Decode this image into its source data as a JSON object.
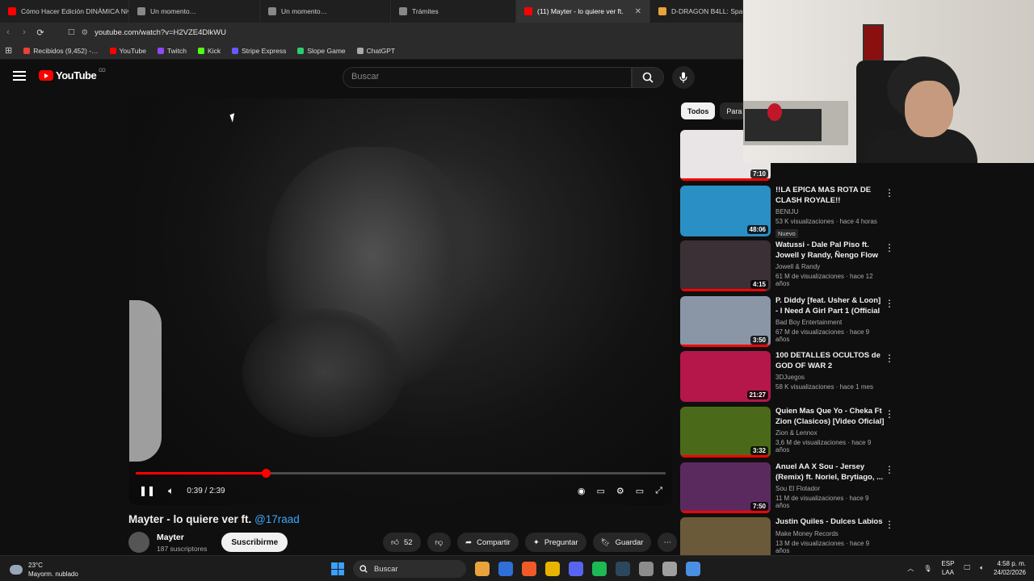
{
  "browser": {
    "tabs": [
      {
        "label": "Cómo Hacer Edición DINÁMICA Niv",
        "color": "#ff0000"
      },
      {
        "label": "Un momento…",
        "color": "#888888"
      },
      {
        "label": "Un momento…",
        "color": "#888888"
      },
      {
        "label": "Trámites",
        "color": "#888888"
      },
      {
        "label": "(11) Mayter - lo quiere ver ft.",
        "color": "#ff0000",
        "active": true
      },
      {
        "label": "D-DRAGON B4LL: Spar",
        "color": "#e8a33c"
      }
    ],
    "url": "youtube.com/watch?v=H2VZE4DlkWU",
    "bookmarks": [
      {
        "label": "Recibidos (9,452) -…",
        "color": "#ea4335"
      },
      {
        "label": "YouTube",
        "color": "#ff0000"
      },
      {
        "label": "Twitch",
        "color": "#9146ff"
      },
      {
        "label": "Kick",
        "color": "#53fc18"
      },
      {
        "label": "Stripe Express",
        "color": "#635bff"
      },
      {
        "label": "Slope Game",
        "color": "#2ecc71"
      },
      {
        "label": "ChatGPT",
        "color": "#aaaaaa"
      }
    ]
  },
  "youtube": {
    "logo_text": "YouTube",
    "logo_region": "CO",
    "search_placeholder": "Buscar",
    "player": {
      "time": "0:39 / 2:39",
      "progress": 0.245
    },
    "video": {
      "title": "Mayter - lo quiere ver ft.",
      "tag": "@17raad",
      "channel": "Mayter",
      "subscribers": "187 suscriptores",
      "subscribe_label": "Suscribirme",
      "likes": "52",
      "share_label": "Compartir",
      "ask_label": "Preguntar",
      "save_label": "Guardar"
    },
    "chips": [
      "Todos",
      "Para"
    ],
    "recommendations": [
      {
        "title": "",
        "channel": "",
        "stats": "",
        "duration": "7:10",
        "thumb": "#e9e4e6",
        "progress": 1.0
      },
      {
        "title": "!!LA EPICA MAS ROTA DE CLASH ROYALE!!",
        "channel": "BENIJU",
        "stats": "53 K visualizaciones · hace 4 horas",
        "duration": "48:06",
        "badge": "Nuevo",
        "thumb": "#2a8fc4"
      },
      {
        "title": "Watussi - Dale Pal Piso ft. Jowell y Randy, Ñengo Flow ...",
        "channel": "Jowell & Randy",
        "stats": "61 M de visualizaciones · hace 12 años",
        "duration": "4:15",
        "thumb": "#3a3036",
        "progress": 0.95
      },
      {
        "title": "P. Diddy [feat. Usher & Loon] - I Need A Girl Part 1 (Official ...",
        "channel": "Bad Boy Entertainment",
        "stats": "67 M de visualizaciones · hace 9 años",
        "duration": "3:50",
        "thumb": "#8a96a6",
        "progress": 1.0
      },
      {
        "title": "100 DETALLES OCULTOS de GOD OF WAR 2",
        "channel": "3DJuegos",
        "stats": "58 K visualizaciones · hace 1 mes",
        "duration": "21:27",
        "thumb": "#b5174a"
      },
      {
        "title": "Quien Mas Que Yo -  Cheka Ft Zion (Clasicos) [Video Oficial]",
        "channel": "Zion & Lennox",
        "stats": "3,6 M de visualizaciones · hace 9 años",
        "duration": "3:32",
        "thumb": "#4a6a1a",
        "progress": 1.0
      },
      {
        "title": "Anuel AA X Sou - Jersey (Remix) ft. Noriel, Brytiago, ...",
        "channel": "Sou El Flotador",
        "stats": "11 M de visualizaciones · hace 9 años",
        "duration": "7:50",
        "thumb": "#5a2a5e",
        "progress": 1.0
      },
      {
        "title": "Justin Quiles - Dulces Labios",
        "channel": "Make Money Records",
        "stats": "13 M de visualizaciones · hace 9 años",
        "duration": "",
        "thumb": "#6a5a3a"
      }
    ]
  },
  "taskbar": {
    "weather_temp": "23°C",
    "weather_desc": "Mayorm. nublado",
    "search_label": "Buscar",
    "lang": "ESP",
    "lang_region": "LAA",
    "time": "4:58 p. m.",
    "date": "24/02/2026",
    "apps": [
      "#e8a33c",
      "#2f6fd8",
      "#f05a28",
      "#e8b400",
      "#5865f2",
      "#1db954",
      "#2a475e",
      "#8c8c8c",
      "#a0a0a0",
      "#4a90e2"
    ]
  }
}
